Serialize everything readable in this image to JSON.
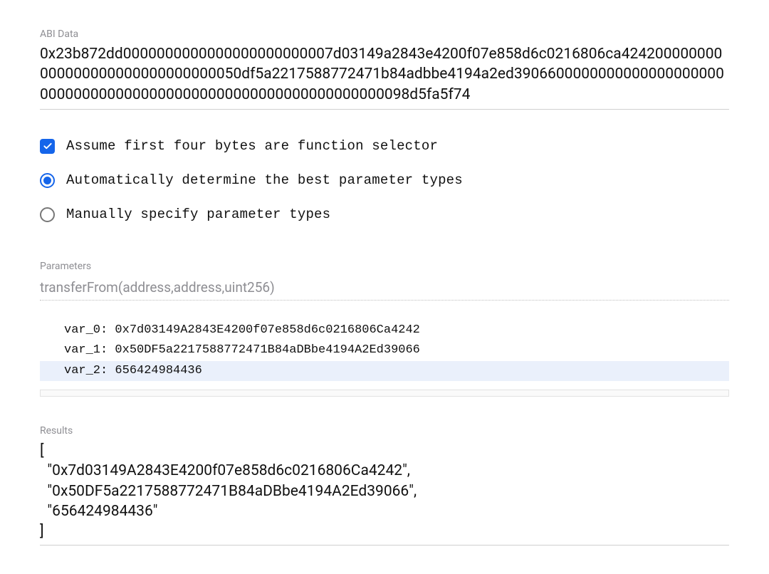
{
  "labels": {
    "abi_data": "ABI Data",
    "parameters": "Parameters",
    "results": "Results"
  },
  "abi_data_value": "0x23b872dd0000000000000000000000007d03149a2843e4200f07e858d6c0216806ca424200000000000000000000000000000050df5a2217588772471b84adbbe4194a2ed390660000000000000000000000000000000000000000000000000000000000000098d5fa5f74",
  "options": {
    "assume_selector": {
      "label": "Assume first four bytes are function selector",
      "checked": true
    },
    "auto_types": {
      "label": "Automatically determine the best parameter types",
      "selected": true
    },
    "manual_types": {
      "label": "Manually specify parameter types",
      "selected": false
    }
  },
  "parameters_placeholder": "transferFrom(address,address,uint256)",
  "decoded_vars": [
    {
      "text": "var_0: 0x7d03149A2843E4200f07e858d6c0216806Ca4242",
      "highlight": false
    },
    {
      "text": "var_1: 0x50DF5a2217588772471B84aDBbe4194A2Ed39066",
      "highlight": false
    },
    {
      "text": "var_2: 656424984436",
      "highlight": true
    }
  ],
  "results_text": "[\n  \"0x7d03149A2843E4200f07e858d6c0216806Ca4242\",\n  \"0x50DF5a2217588772471B84aDBbe4194A2Ed39066\",\n  \"656424984436\"\n]"
}
